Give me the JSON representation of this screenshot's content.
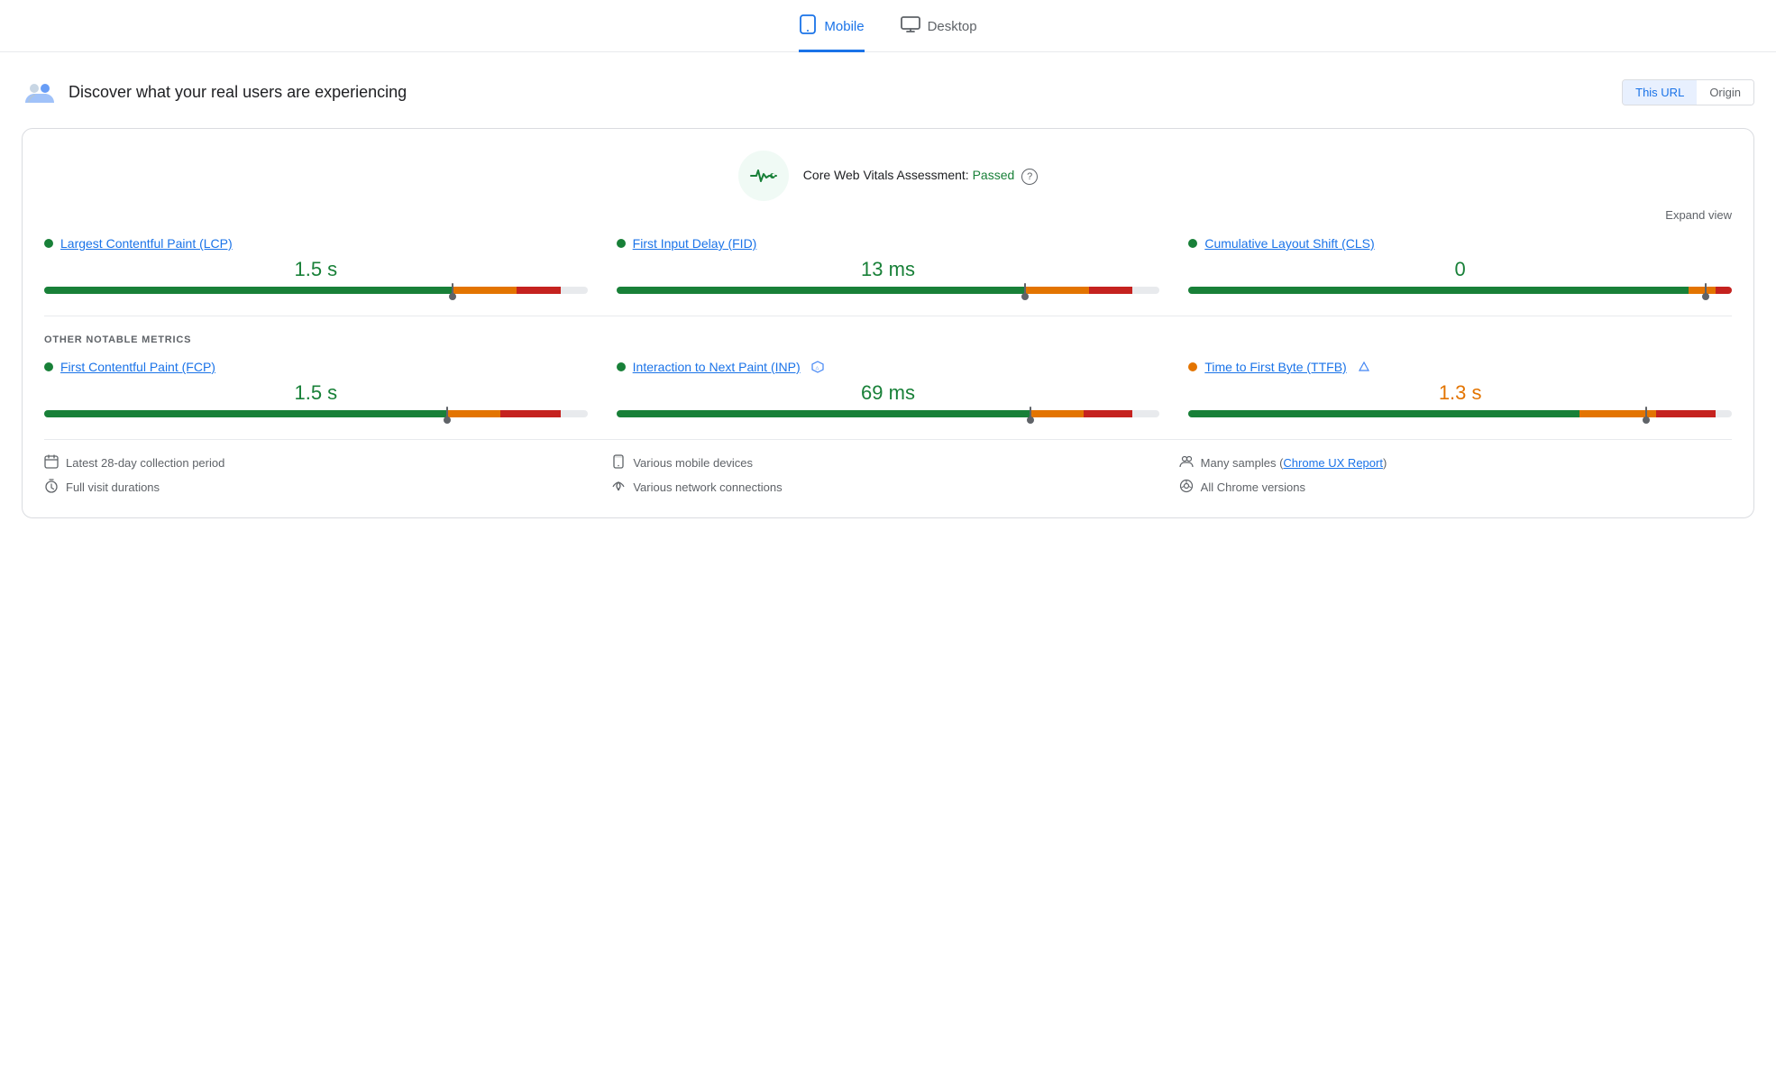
{
  "tabs": [
    {
      "id": "mobile",
      "label": "Mobile",
      "active": true
    },
    {
      "id": "desktop",
      "label": "Desktop",
      "active": false
    }
  ],
  "header": {
    "title": "Discover what your real users are experiencing",
    "url_button": "This URL",
    "origin_button": "Origin"
  },
  "cwv": {
    "title": "Core Web Vitals Assessment:",
    "status": "Passed",
    "help_label": "?",
    "expand_label": "Expand view"
  },
  "metrics": [
    {
      "id": "lcp",
      "dot_color": "green",
      "name": "Largest Contentful Paint (LCP)",
      "value": "1.5 s",
      "value_color": "green",
      "bar": {
        "green": 75,
        "orange": 12,
        "red": 8,
        "needle": 75
      }
    },
    {
      "id": "fid",
      "dot_color": "green",
      "name": "First Input Delay (FID)",
      "value": "13 ms",
      "value_color": "green",
      "bar": {
        "green": 75,
        "orange": 12,
        "red": 8,
        "needle": 75
      }
    },
    {
      "id": "cls",
      "dot_color": "green",
      "name": "Cumulative Layout Shift (CLS)",
      "value": "0",
      "value_color": "green",
      "bar": {
        "green": 92,
        "orange": 5,
        "red": 3,
        "needle": 95
      }
    }
  ],
  "other_metrics_label": "OTHER NOTABLE METRICS",
  "other_metrics": [
    {
      "id": "fcp",
      "dot_color": "green",
      "name": "First Contentful Paint (FCP)",
      "value": "1.5 s",
      "value_color": "green",
      "has_beta": false,
      "bar": {
        "green": 74,
        "orange": 10,
        "red": 11,
        "needle": 74
      }
    },
    {
      "id": "inp",
      "dot_color": "green",
      "name": "Interaction to Next Paint (INP)",
      "value": "69 ms",
      "value_color": "green",
      "has_beta": true,
      "bar": {
        "green": 76,
        "orange": 10,
        "red": 9,
        "needle": 76
      }
    },
    {
      "id": "ttfb",
      "dot_color": "orange",
      "name": "Time to First Byte (TTFB)",
      "value": "1.3 s",
      "value_color": "orange",
      "has_beta": true,
      "bar": {
        "green": 72,
        "orange": 14,
        "red": 11,
        "needle": 84
      }
    }
  ],
  "footer": [
    {
      "icon": "📅",
      "text": "Latest 28-day collection period"
    },
    {
      "icon": "📱",
      "text": "Various mobile devices"
    },
    {
      "icon": "👥",
      "text": "Many samples",
      "link": "Chrome UX Report",
      "link_after": true
    },
    {
      "icon": "⏱",
      "text": "Full visit durations"
    },
    {
      "icon": "📶",
      "text": "Various network connections"
    },
    {
      "icon": "🌐",
      "text": "All Chrome versions"
    }
  ]
}
